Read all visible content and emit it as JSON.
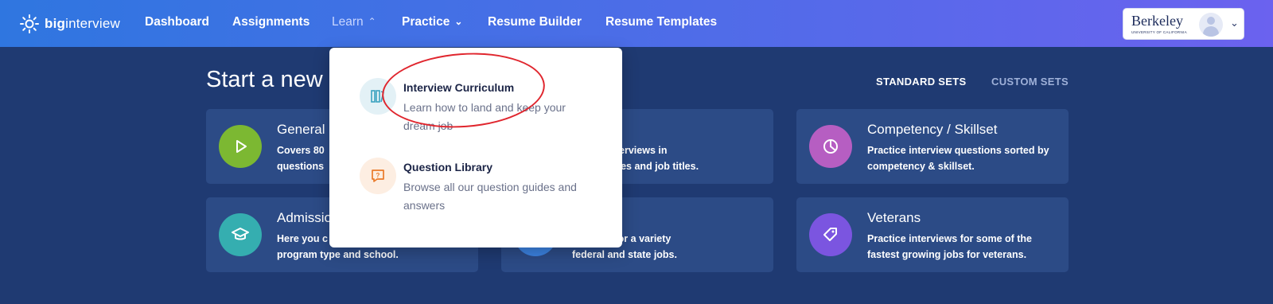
{
  "nav": {
    "logo_bold": "big",
    "logo_light": "interview",
    "items": [
      {
        "label": "Dashboard"
      },
      {
        "label": "Assignments"
      },
      {
        "label": "Learn"
      },
      {
        "label": "Practice"
      },
      {
        "label": "Resume Builder"
      },
      {
        "label": "Resume Templates"
      }
    ]
  },
  "user": {
    "org_logo": "Berkeley",
    "org_logo_sub": "UNIVERSITY OF CALIFORNIA",
    "avatar_icon": "user-avatar-icon",
    "menu_icon": "chevron-down-icon"
  },
  "main": {
    "title": "Start a new",
    "tabs": [
      {
        "label": "STANDARD SETS",
        "active": true
      },
      {
        "label": "CUSTOM SETS",
        "active": false
      }
    ],
    "cards": [
      {
        "title": "General",
        "desc": "Covers 80",
        "desc2": "questions",
        "icon": "play-icon",
        "color": "#7cb832"
      },
      {
        "title": "",
        "desc": "cticing interviews in",
        "desc2": "of industries and job titles.",
        "icon": "briefcase-icon",
        "color": "#3b82e0"
      },
      {
        "title": "Competency / Skillset",
        "desc": "Practice interview questions sorted by competency & skillset.",
        "icon": "pie-chart-icon",
        "color": "#b65ec2"
      },
      {
        "title": "Admissio",
        "desc": "Here you c",
        "desc2": "program type and school.",
        "icon": "graduation-cap-icon",
        "color": "#35aeb0"
      },
      {
        "title": "ment",
        "desc": "terviews for a variety",
        "desc2": "federal and state jobs.",
        "icon": "flag-icon",
        "color": "#3b82e0"
      },
      {
        "title": "Veterans",
        "desc": "Practice interviews for some of the fastest growing jobs for veterans.",
        "icon": "tag-icon",
        "color": "#7b55e0"
      }
    ]
  },
  "dropdown": {
    "items": [
      {
        "title": "Interview Curriculum",
        "desc": "Learn how to land and keep your dream job",
        "icon": "books-icon"
      },
      {
        "title": "Question Library",
        "desc": "Browse all our question guides and answers",
        "icon": "question-bubble-icon"
      }
    ]
  },
  "colors": {
    "nav_gradient_start": "#2f76e0",
    "nav_gradient_end": "#6b62ef",
    "page_bg": "#1f3a72",
    "card_bg": "#2c4b86",
    "annotation": "#e0262e"
  }
}
